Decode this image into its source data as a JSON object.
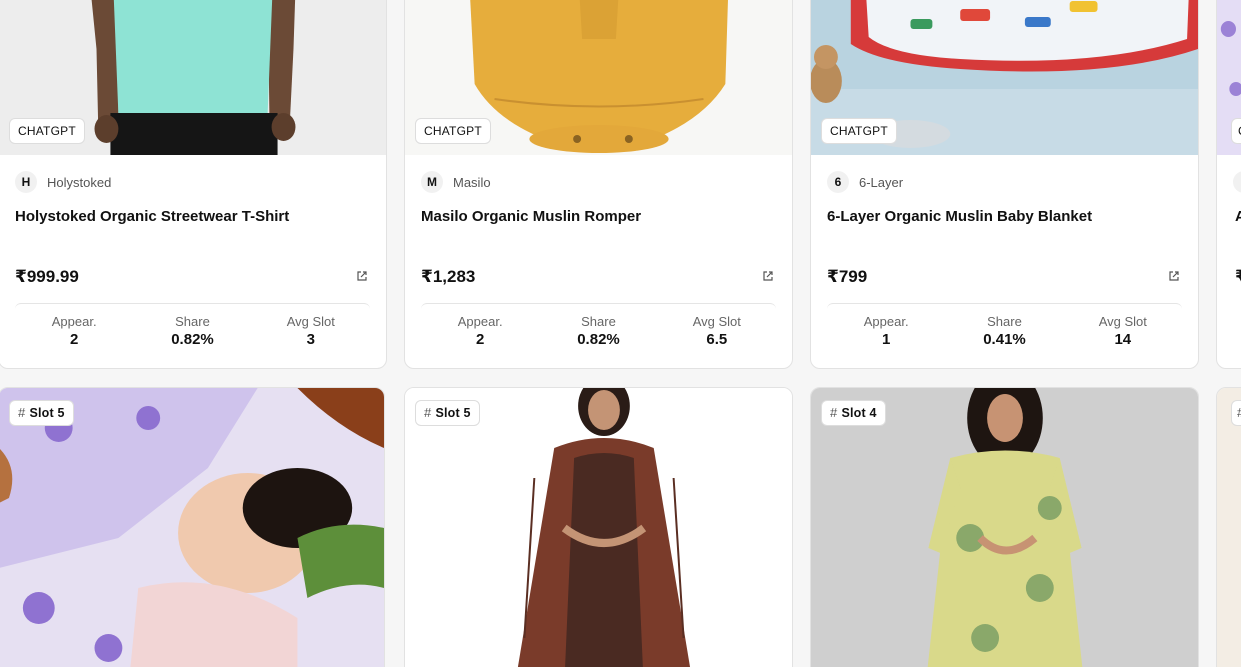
{
  "top_cards": [
    {
      "badge": "CHATGPT",
      "brand_initial": "H",
      "brand": "Holystoked",
      "title": "Holystoked Organic Streetwear T-Shirt",
      "price": "₹999.99",
      "stats": [
        {
          "label": "Appear.",
          "value": "2"
        },
        {
          "label": "Share",
          "value": "0.82%"
        },
        {
          "label": "Avg Slot",
          "value": "3"
        }
      ]
    },
    {
      "badge": "CHATGPT",
      "brand_initial": "M",
      "brand": "Masilo",
      "title": "Masilo Organic Muslin Romper",
      "price": "₹1,283",
      "stats": [
        {
          "label": "Appear.",
          "value": "2"
        },
        {
          "label": "Share",
          "value": "0.82%"
        },
        {
          "label": "Avg Slot",
          "value": "6.5"
        }
      ]
    },
    {
      "badge": "CHATGPT",
      "brand_initial": "6",
      "brand": "6-Layer",
      "title": "6-Layer Organic Muslin Baby Blanket",
      "price": "₹799",
      "stats": [
        {
          "label": "Appear.",
          "value": "1"
        },
        {
          "label": "Share",
          "value": "0.41%"
        },
        {
          "label": "Avg Slot",
          "value": "14"
        }
      ]
    }
  ],
  "bottom_cards": [
    {
      "badge": "Slot 5"
    },
    {
      "badge": "Slot 5"
    },
    {
      "badge": "Slot 4"
    }
  ],
  "partial_card": {
    "price_fragment": "₹",
    "title_fragment": "A",
    "tag_fragment": "C"
  },
  "icons": {
    "external_link": "external-link-icon",
    "hash": "hash-icon"
  }
}
